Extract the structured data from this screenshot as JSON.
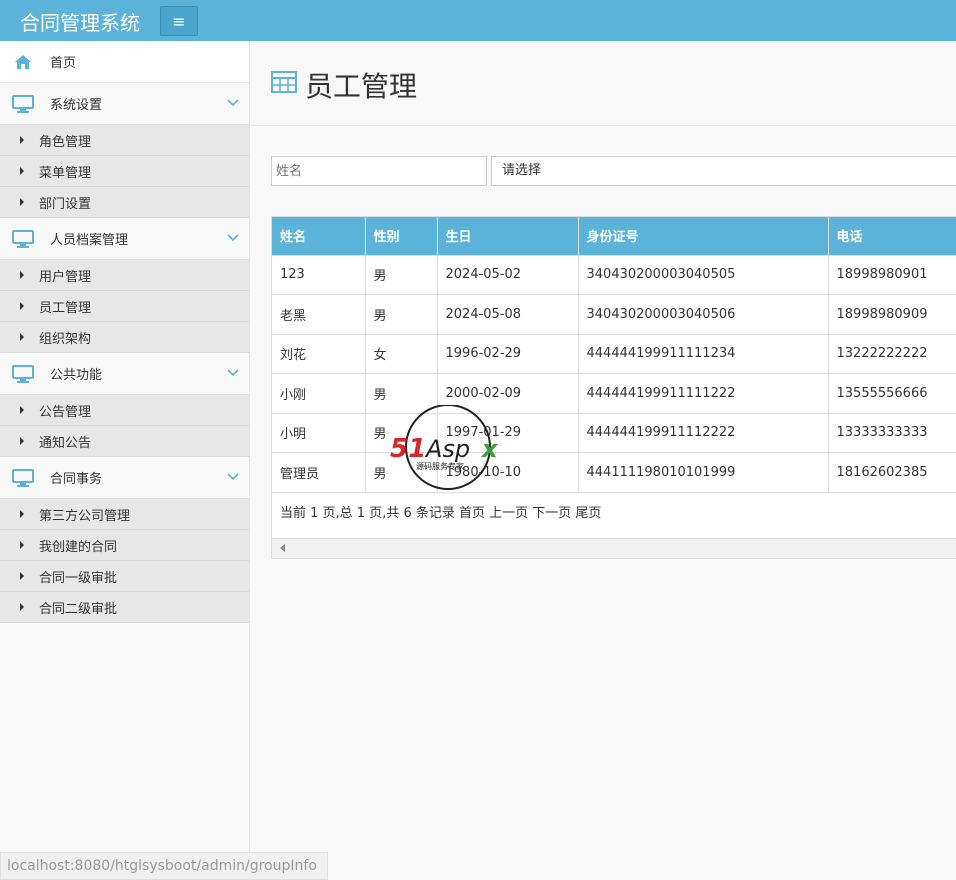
{
  "app": {
    "title": "合同管理系统",
    "menu_icon": "hamburger-icon"
  },
  "sidebar": {
    "home": {
      "label": "首页",
      "icon": "home-icon"
    },
    "groups": [
      {
        "label": "系统设置",
        "icon": "monitor-icon",
        "items": [
          "角色管理",
          "菜单管理",
          "部门设置"
        ]
      },
      {
        "label": "人员档案管理",
        "icon": "monitor-icon",
        "items": [
          "用户管理",
          "员工管理",
          "组织架构"
        ]
      },
      {
        "label": "公共功能",
        "icon": "monitor-icon",
        "items": [
          "公告管理",
          "通知公告"
        ]
      },
      {
        "label": "合同事务",
        "icon": "monitor-icon",
        "items": [
          "第三方公司管理",
          "我创建的合同",
          "合同一级审批",
          "合同二级审批"
        ]
      }
    ]
  },
  "main": {
    "title": "员工管理",
    "title_icon": "table-icon",
    "search": {
      "name_placeholder": "姓名",
      "select_value": "请选择"
    },
    "table": {
      "headers": [
        "姓名",
        "性别",
        "生日",
        "身份证号",
        "电话"
      ],
      "rows": [
        [
          "123",
          "男",
          "2024-05-02",
          "340430200003040505",
          "18998980901"
        ],
        [
          "老黑",
          "男",
          "2024-05-08",
          "340430200003040506",
          "18998980909"
        ],
        [
          "刘花",
          "女",
          "1996-02-29",
          "444444199911111234",
          "13222222222"
        ],
        [
          "小刚",
          "男",
          "2000-02-09",
          "444444199911111222",
          "13555556666"
        ],
        [
          "小明",
          "男",
          "1997-01-29",
          "444444199911112222",
          "13333333333"
        ],
        [
          "管理员",
          "男",
          "1980-10-10",
          "444111198010101999",
          "18162602385"
        ]
      ]
    },
    "pager": "当前 1 页,总 1 页,共 6 条记录 首页 上一页 下一页 尾页"
  },
  "watermark": {
    "brand": "51Aspx",
    "tagline": "源码服务专家"
  },
  "status_url": "localhost:8080/htglsysboot/admin/groupInfo",
  "colors": {
    "header": "#5bb3d9",
    "icon": "#5bb3d9"
  }
}
